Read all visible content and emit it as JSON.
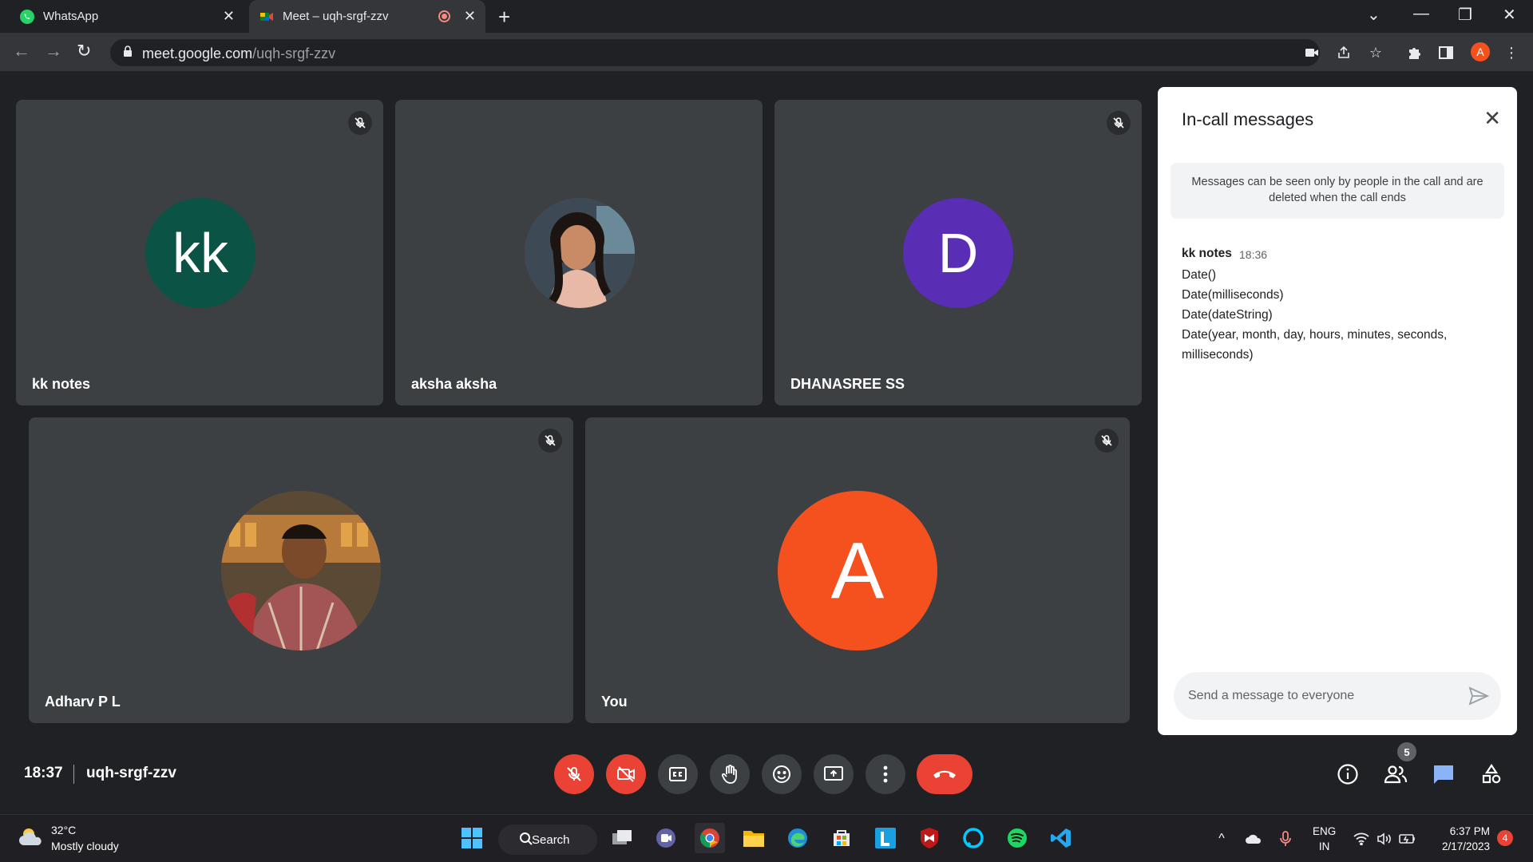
{
  "browser": {
    "tabs": [
      {
        "label": "WhatsApp"
      },
      {
        "label": "Meet – uqh-srgf-zzv"
      }
    ],
    "url_host": "meet.google.com",
    "url_path": "/uqh-srgf-zzv",
    "profile_initial": "A"
  },
  "tiles": [
    {
      "name": "kk notes",
      "initials": "kk",
      "color": "#0b5345"
    },
    {
      "name": "aksha aksha"
    },
    {
      "name": "DHANASREE SS",
      "initials": "D",
      "color": "#5a2db5"
    },
    {
      "name": "Adharv P L"
    },
    {
      "name": "You",
      "initials": "A",
      "color": "#f4511e"
    }
  ],
  "chat": {
    "title": "In-call messages",
    "notice": "Messages can be seen only by people in the call and are deleted when the call ends",
    "message": {
      "sender": "kk notes",
      "time": "18:36",
      "lines": [
        "Date()",
        "Date(milliseconds)",
        "Date(dateString)",
        "Date(year, month, day, hours, minutes, seconds,",
        "milliseconds)"
      ]
    },
    "input_placeholder": "Send a message to everyone"
  },
  "meeting": {
    "time": "18:37",
    "code": "uqh-srgf-zzv",
    "participant_count": "5"
  },
  "taskbar": {
    "weather_temp": "32°C",
    "weather_desc": "Mostly cloudy",
    "search_label": "Search",
    "lang_line1": "ENG",
    "lang_line2": "IN",
    "clock_time": "6:37 PM",
    "clock_date": "2/17/2023",
    "notification_count": "4"
  },
  "colors": {
    "meet_bg": "#202124",
    "tile_bg": "#3c4043",
    "danger": "#ea4335",
    "accent_blue": "#8ab4f8"
  }
}
